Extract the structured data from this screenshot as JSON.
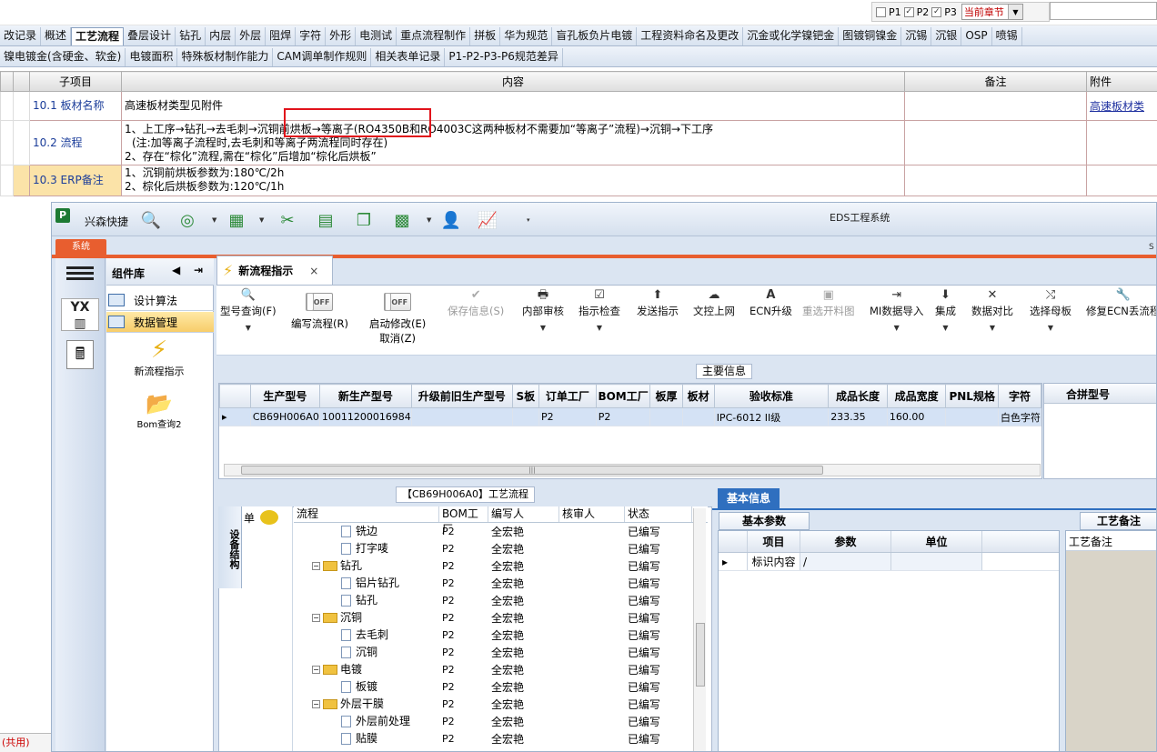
{
  "filter": {
    "p1": "P1",
    "p2": "P2",
    "p3": "P3",
    "chapter": "当前章节"
  },
  "tabs_row1": [
    "改记录",
    "概述",
    "工艺流程",
    "叠层设计",
    "钻孔",
    "内层",
    "外层",
    "阻焊",
    "字符",
    "外形",
    "电测试",
    "重点流程制作",
    "拼板",
    "华为规范",
    "盲孔板负片电镀",
    "工程资料命名及更改",
    "沉金或化学镍钯金",
    "图镀铜镍金",
    "沉锡",
    "沉银",
    "OSP",
    "喷锡"
  ],
  "tabs_row1_active": "工艺流程",
  "tabs_row2": [
    "镍电镀金(含硬金、软金)",
    "电镀面积",
    "特殊板材制作能力",
    "CAM调单制作规则",
    "相关表单记录",
    "P1-P2-P3-P6规范差异"
  ],
  "req_table": {
    "headers": {
      "sub": "子项目",
      "content": "内容",
      "remark": "备注",
      "attach": "附件"
    },
    "rows": [
      {
        "sub": "10.1 板材名称",
        "content_l1": "高速板材类型见附件",
        "content_l2": "",
        "content_l3": "",
        "attach": "高速板材类"
      },
      {
        "sub": "10.2 流程",
        "content_l1": "1、上工序→钻孔→去毛刺→沉铜前烘板→等离子(RO4350B和RO4003C这两种板材不需要加“等离子”流程)→沉铜→下工序",
        "content_l2": "(注:加等离子流程时,去毛刺和等离子两流程同时存在)",
        "content_l3": "2、存在“棕化”流程,需在“棕化”后增加“棕化后烘板”",
        "attach": ""
      },
      {
        "sub": "10.3 ERP备注",
        "content_l1": "1、沉铜前烘板参数为:180℃/2h",
        "content_l2": "2、棕化后烘板参数为:120℃/1h",
        "content_l3": "",
        "attach": ""
      }
    ]
  },
  "eds": {
    "quick_label": "兴森快捷",
    "title": "EDS工程系统",
    "sys_tab": "系统",
    "corner": "S",
    "complib_title": "组件库",
    "lib_items": [
      "设计算法",
      "数据管理"
    ],
    "big_icons": [
      "新流程指示",
      "Bom查询2"
    ],
    "yx_label": "YX",
    "doc_tab": "新流程指示",
    "ribbon": [
      {
        "label": "型号查询(F)",
        "icon": "🔍"
      },
      {
        "label": "保存信息(S)",
        "icon": "✔"
      },
      {
        "label": "内部审核",
        "icon": "🖶"
      },
      {
        "label": "指示检查",
        "icon": "☑"
      },
      {
        "label": "发送指示",
        "icon": "⬆"
      },
      {
        "label": "文控上网",
        "icon": "☁"
      },
      {
        "label": "ECN升级",
        "icon": "A"
      },
      {
        "label": "重选开料图",
        "icon": "▣"
      },
      {
        "label": "MI数据导入",
        "icon": "⇥"
      },
      {
        "label": "集成",
        "icon": "⬇"
      },
      {
        "label": "数据对比",
        "icon": "✕"
      },
      {
        "label": "选择母板",
        "icon": "⤭"
      },
      {
        "label": "修复ECN丢流程",
        "icon": "🔧"
      }
    ],
    "toggle1": {
      "label": "编写流程(R)",
      "state": "OFF"
    },
    "toggle2": {
      "label": "启动修改(E)",
      "state": "OFF",
      "sub": "取消(Z)"
    },
    "main_info_label": "主要信息",
    "grid1": {
      "headers": [
        "生产型号",
        "新生产型号",
        "升级前旧生产型号",
        "S板",
        "订单工厂",
        "BOM工厂",
        "板厚",
        "板材",
        "验收标准",
        "成品长度",
        "成品宽度",
        "PNL规格",
        "字符"
      ],
      "row": [
        "CB69H006A0",
        "10011200016984",
        "",
        "",
        "P2",
        "P2",
        "",
        "",
        "IPC-6012 II级",
        "233.35",
        "160.00",
        "",
        "白色字符"
      ]
    },
    "grid2_header": "合拼型号",
    "flow_label": "【CB69H006A0】工艺流程",
    "vtab": "设备结构",
    "msg_label": "单",
    "flow_headers": [
      "流程",
      "BOM工厂",
      "编写人",
      "核审人",
      "状态"
    ],
    "flow_rows": [
      {
        "name": "铣边",
        "type": "doc",
        "lvl": 2,
        "bom": "P2",
        "author": "全宏艳",
        "status": "已编写"
      },
      {
        "name": "打字唛",
        "type": "doc",
        "lvl": 2,
        "bom": "P2",
        "author": "全宏艳",
        "status": "已编写"
      },
      {
        "name": "钻孔",
        "type": "fold",
        "lvl": 1,
        "bom": "P2",
        "author": "全宏艳",
        "status": "已编写"
      },
      {
        "name": "铝片钻孔",
        "type": "doc",
        "lvl": 2,
        "bom": "P2",
        "author": "全宏艳",
        "status": "已编写"
      },
      {
        "name": "钻孔",
        "type": "doc",
        "lvl": 2,
        "bom": "P2",
        "author": "全宏艳",
        "status": "已编写"
      },
      {
        "name": "沉铜",
        "type": "fold",
        "lvl": 1,
        "bom": "P2",
        "author": "全宏艳",
        "status": "已编写"
      },
      {
        "name": "去毛刺",
        "type": "doc",
        "lvl": 2,
        "bom": "P2",
        "author": "全宏艳",
        "status": "已编写"
      },
      {
        "name": "沉铜",
        "type": "doc",
        "lvl": 2,
        "bom": "P2",
        "author": "全宏艳",
        "status": "已编写"
      },
      {
        "name": "电镀",
        "type": "fold",
        "lvl": 1,
        "bom": "P2",
        "author": "全宏艳",
        "status": "已编写"
      },
      {
        "name": "板镀",
        "type": "doc",
        "lvl": 2,
        "bom": "P2",
        "author": "全宏艳",
        "status": "已编写"
      },
      {
        "name": "外层干膜",
        "type": "fold",
        "lvl": 1,
        "bom": "P2",
        "author": "全宏艳",
        "status": "已编写"
      },
      {
        "name": "外层前处理",
        "type": "doc",
        "lvl": 2,
        "bom": "P2",
        "author": "全宏艳",
        "status": "已编写"
      },
      {
        "name": "贴膜",
        "type": "doc",
        "lvl": 2,
        "bom": "P2",
        "author": "全宏艳",
        "status": "已编写"
      }
    ],
    "basic_info": "基本信息",
    "param_tab": "基本参数",
    "param_headers": [
      "项目",
      "参数",
      "单位"
    ],
    "param_row": [
      "标识内容",
      "/",
      ""
    ],
    "proc_note_tab": "工艺备注",
    "proc_note_header": "工艺备注"
  },
  "bottom_left": "(共用)"
}
